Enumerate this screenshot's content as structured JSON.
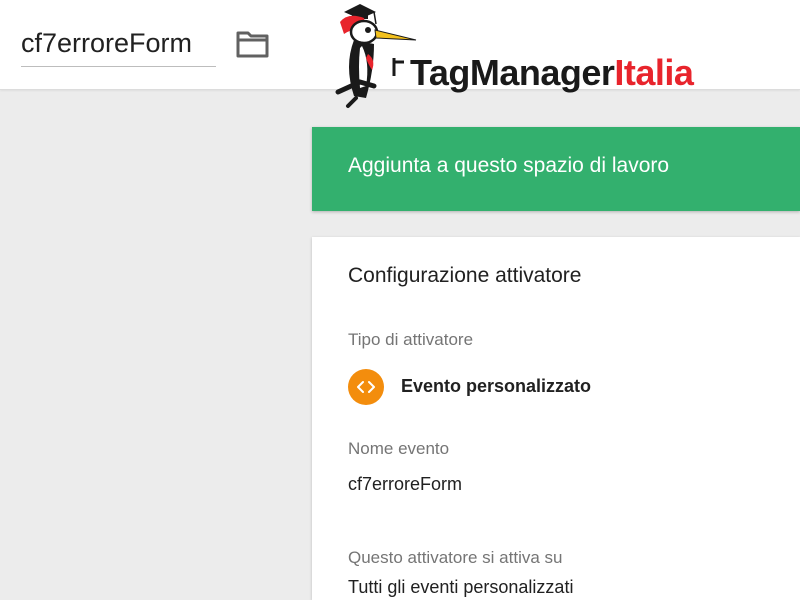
{
  "header": {
    "trigger_name": "cf7erroreForm",
    "folder_icon": "folder-icon"
  },
  "logo": {
    "text_black": "TagManager",
    "text_red": "Italia",
    "mascot_icon": "woodpecker-graduate-icon",
    "colors": {
      "black": "#1a1a1a",
      "red": "#e8242c"
    }
  },
  "banner": {
    "label": "Aggiunta a questo spazio di lavoro",
    "color": "#33b06e"
  },
  "card": {
    "title": "Configurazione attivatore",
    "trigger_type_label": "Tipo di attivatore",
    "trigger_type_value": "Evento personalizzato",
    "trigger_type_icon": "code-brackets-icon",
    "trigger_type_icon_color": "#f38d0d",
    "event_name_label": "Nome evento",
    "event_name_value": "cf7erroreForm",
    "fires_on_label": "Questo attivatore si attiva su",
    "fires_on_value": "Tutti gli eventi personalizzati"
  }
}
